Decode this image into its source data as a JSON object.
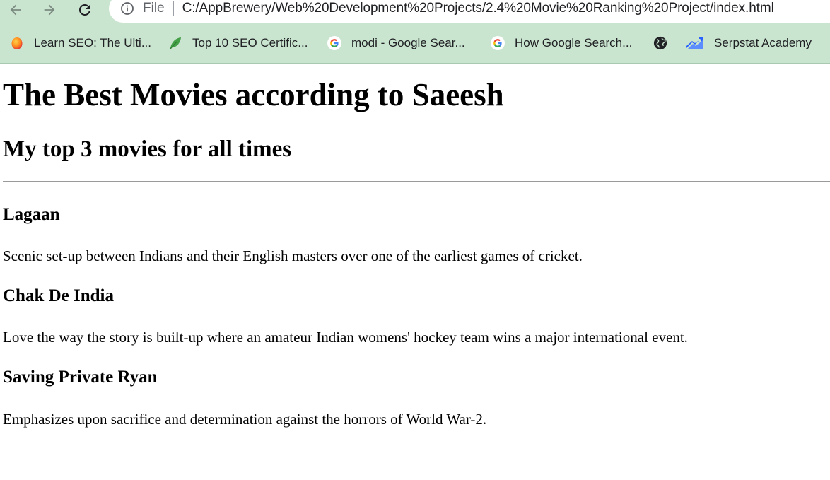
{
  "browser": {
    "file_label": "File",
    "url": "C:/AppBrewery/Web%20Development%20Projects/2.4%20Movie%20Ranking%20Project/index.html",
    "bookmarks": [
      {
        "label": "Learn SEO: The Ulti...",
        "icon": "orange-circle-icon"
      },
      {
        "label": "Top 10 SEO Certific...",
        "icon": "leaf-icon"
      },
      {
        "label": "modi - Google Sear...",
        "icon": "google-icon"
      },
      {
        "label": "How Google Search...",
        "icon": "google-icon"
      },
      {
        "label": "",
        "icon": "globe-icon"
      },
      {
        "label": "Serpstat Academy",
        "icon": "serpstat-icon"
      }
    ],
    "colors": {
      "chrome_bg": "#c9e4cf",
      "omnibox_bg": "#ffffff"
    }
  },
  "page": {
    "title": "The Best Movies according to Saeesh",
    "subtitle": "My top 3 movies for all times",
    "movies": [
      {
        "name": "Lagaan",
        "description": "Scenic set-up between Indians and their English masters over one of the earliest games of cricket."
      },
      {
        "name": "Chak De India",
        "description": "Love the way the story is built-up where an amateur Indian womens' hockey team wins a major international event."
      },
      {
        "name": "Saving Private Ryan",
        "description": "Emphasizes upon sacrifice and determination against the horrors of World War-2."
      }
    ]
  }
}
